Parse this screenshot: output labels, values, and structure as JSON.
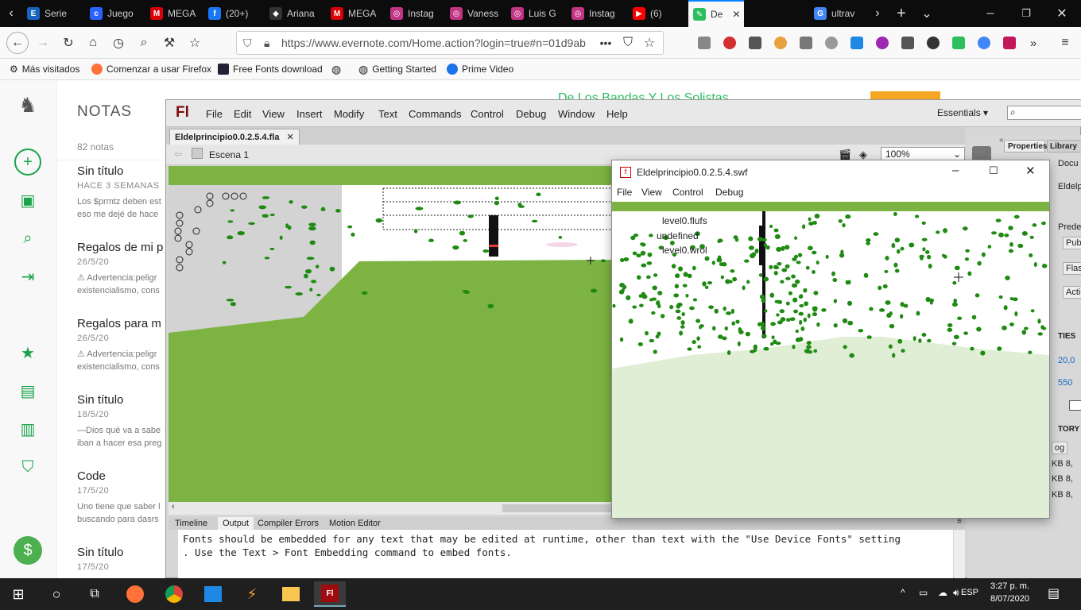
{
  "browser": {
    "tabs": [
      {
        "label": "Serie",
        "icon": "E",
        "color": "#1565c0"
      },
      {
        "label": "Juego",
        "icon": "c",
        "color": "#2962ff"
      },
      {
        "label": "MEGA",
        "icon": "M",
        "color": "#d90007"
      },
      {
        "label": "(20+)",
        "icon": "f",
        "color": "#1877f2"
      },
      {
        "label": "Ariana",
        "icon": "◆",
        "color": "#333333"
      },
      {
        "label": "MEGA",
        "icon": "M",
        "color": "#d90007"
      },
      {
        "label": "Instag",
        "icon": "◎",
        "color": "#c13584"
      },
      {
        "label": "Vaness",
        "icon": "◎",
        "color": "#c13584"
      },
      {
        "label": "Luis G",
        "icon": "◎",
        "color": "#c13584"
      },
      {
        "label": "Instag",
        "icon": "◎",
        "color": "#c13584"
      },
      {
        "label": "(6)",
        "icon": "▶",
        "color": "#ff0000"
      },
      {
        "label": "De",
        "icon": "✎",
        "color": "#2dbe60"
      },
      {
        "label": "ultrav",
        "icon": "G",
        "color": "#4285f4"
      }
    ],
    "url": "https://www.evernote.com/Home.action?login=true#n=01d9ab",
    "bookmarks": [
      "Más visitados",
      "Comenzar a usar Firefox",
      "Free Fonts download",
      "Getting Started",
      "Prime Video"
    ]
  },
  "evernote": {
    "header": "NOTAS",
    "count": "82 notas",
    "page_heading": "De Los Bandas Y Los Solistas",
    "notes": [
      {
        "title": "Sin título",
        "date": "HACE 3 SEMANAS",
        "preview1": "Los $prmtz deben est",
        "preview2": "eso me dejé de hace"
      },
      {
        "title": "Regalos de mi p",
        "date": "26/5/20",
        "preview1": "⚠ Advertencia:peligr",
        "preview2": "existencialismo, cons"
      },
      {
        "title": "Regalos para m",
        "date": "26/5/20",
        "preview1": "⚠ Advertencia:peligr",
        "preview2": "existencialismo, cons"
      },
      {
        "title": "Sin título",
        "date": "18/5/20",
        "preview1": "—Dios qué va a sabe",
        "preview2": "iban a hacer esa preg"
      },
      {
        "title": "Code",
        "date": "17/5/20",
        "preview1": "Uno tiene que saber l",
        "preview2": "buscando para dasrs"
      },
      {
        "title": "Sin título",
        "date": "17/5/20",
        "preview1": "",
        "preview2": ""
      }
    ]
  },
  "flash": {
    "logo": "Fl",
    "menu": [
      "File",
      "Edit",
      "View",
      "Insert",
      "Modify",
      "Text",
      "Commands",
      "Control",
      "Debug",
      "Window",
      "Help"
    ],
    "workspace": "Essentials",
    "doc_tab": "Eldelprincipio0.0.2.5.4.fla",
    "scene": "Escena 1",
    "zoom": "100%",
    "panel_tabs": [
      "Properties",
      "Library"
    ],
    "panel_labels": [
      "Docu",
      "Eldelp",
      "Prede",
      "Publ",
      "Flas",
      "Actio",
      "TIES",
      "20,0",
      "550",
      "TORY",
      "og",
      "KB  8,",
      "KB  8,",
      "KB  8,"
    ],
    "output_tabs": [
      "Timeline",
      "Output",
      "Compiler Errors",
      "Motion Editor"
    ],
    "output_line1": "Fonts should be embedded for any text that may be edited at runtime, other than text with the \"Use Device Fonts\" setting",
    "output_line2": ". Use the Text > Font Embedding command to embed fonts."
  },
  "swf": {
    "title": "Eldelprincipio0.0.2.5.4.swf",
    "menu": [
      "File",
      "View",
      "Control",
      "Debug"
    ],
    "trace1": "level0.flufs",
    "trace2": "undefined",
    "trace3": "level0.wrol"
  },
  "taskbar": {
    "lang": "ESP",
    "time": "3:27 p. m.",
    "date": "8/07/2020"
  },
  "colors": {
    "green": "#7cb342",
    "dark_green": "#1f8a12",
    "pale": "#dfeed5"
  }
}
